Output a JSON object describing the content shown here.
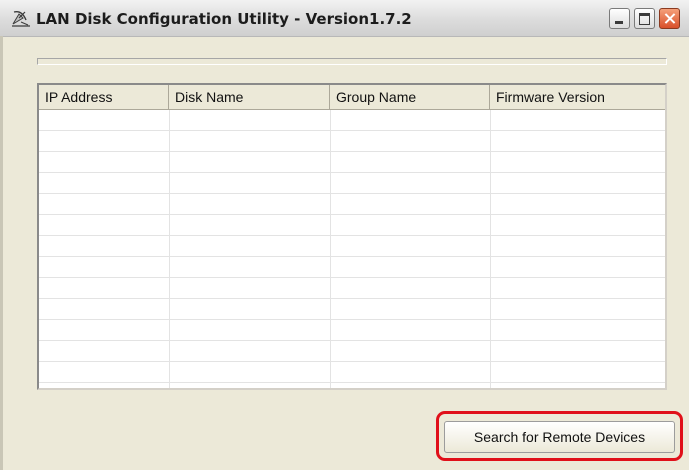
{
  "window": {
    "title": "LAN Disk Configuration Utility - Version1.7.2",
    "app_icon": "satellite-dish-icon",
    "controls": {
      "minimize": "minimize-icon",
      "maximize": "maximize-icon",
      "close": "close-icon"
    }
  },
  "device_list": {
    "columns": [
      "IP Address",
      "Disk Name",
      "Group Name",
      "Firmware Version"
    ],
    "rows": []
  },
  "actions": {
    "search_label": "Search for Remote Devices"
  },
  "colors": {
    "window_bg": "#ece9d8",
    "highlight": "#e0101a",
    "close_button": "#d9502a"
  }
}
